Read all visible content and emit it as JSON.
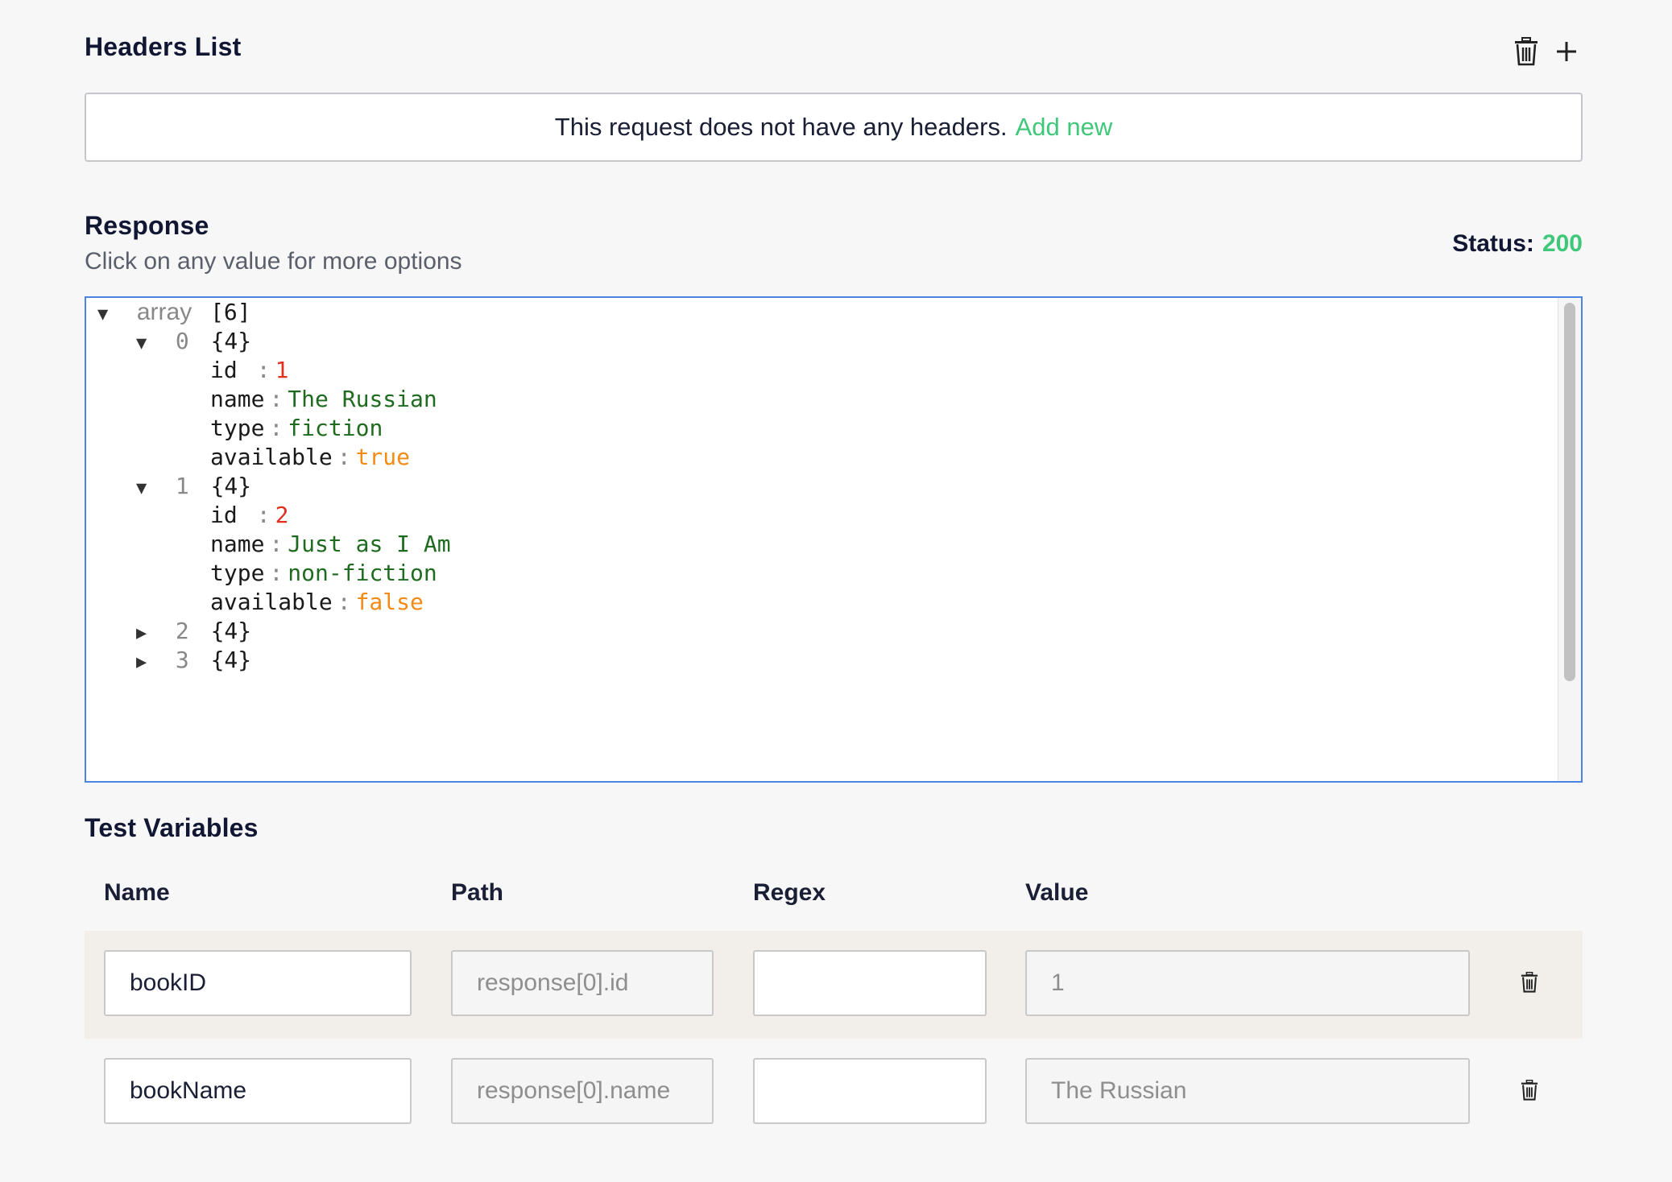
{
  "headers": {
    "title": "Headers List",
    "empty_text": "This request does not have any headers.",
    "add_new_label": "Add new"
  },
  "response": {
    "title": "Response",
    "subtitle": "Click on any value for more options",
    "status_label": "Status:",
    "status_code": "200",
    "tree": {
      "root_label": "array",
      "root_count": "[6]",
      "items": [
        {
          "index": "0",
          "count": "{4}",
          "expanded": true,
          "fields": [
            {
              "key": "id",
              "value": "1",
              "type": "number"
            },
            {
              "key": "name",
              "value": "The Russian",
              "type": "string"
            },
            {
              "key": "type",
              "value": "fiction",
              "type": "string"
            },
            {
              "key": "available",
              "value": "true",
              "type": "boolean"
            }
          ]
        },
        {
          "index": "1",
          "count": "{4}",
          "expanded": true,
          "fields": [
            {
              "key": "id",
              "value": "2",
              "type": "number"
            },
            {
              "key": "name",
              "value": "Just as I Am",
              "type": "string"
            },
            {
              "key": "type",
              "value": "non-fiction",
              "type": "string"
            },
            {
              "key": "available",
              "value": "false",
              "type": "boolean"
            }
          ]
        },
        {
          "index": "2",
          "count": "{4}",
          "expanded": false
        },
        {
          "index": "3",
          "count": "{4}",
          "expanded": false
        }
      ]
    }
  },
  "test_variables": {
    "title": "Test Variables",
    "columns": {
      "name": "Name",
      "path": "Path",
      "regex": "Regex",
      "value": "Value"
    },
    "rows": [
      {
        "name": "bookID",
        "path": "response[0].id",
        "regex": "",
        "value": "1"
      },
      {
        "name": "bookName",
        "path": "response[0].name",
        "regex": "",
        "value": "The Russian"
      }
    ]
  },
  "colors": {
    "accent_green": "#3fc87a",
    "focus_blue": "#4a84e0",
    "number": "#e0311e",
    "string": "#1f6b1f",
    "boolean": "#f28a14"
  }
}
